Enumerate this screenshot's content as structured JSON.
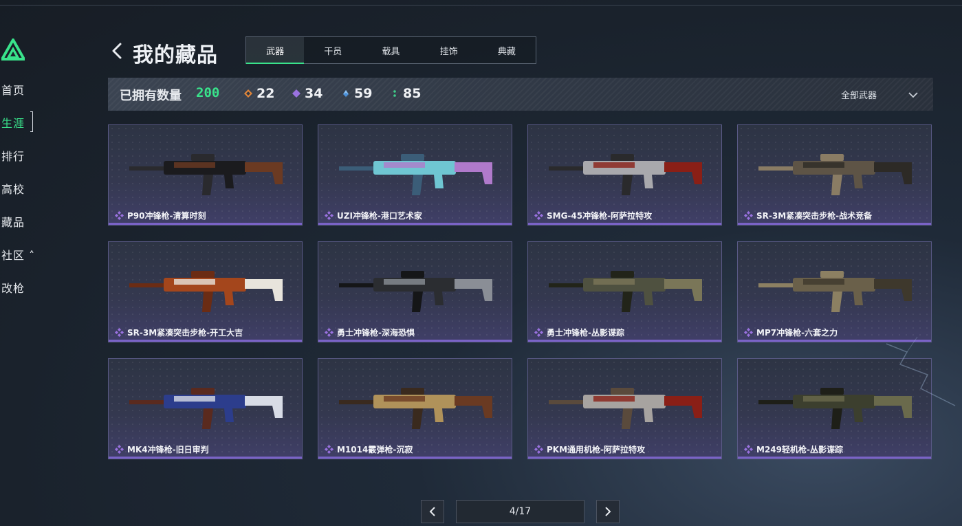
{
  "sidebar": {
    "items": [
      {
        "label": "首页"
      },
      {
        "label": "生涯"
      },
      {
        "label": "排行"
      },
      {
        "label": "高校"
      },
      {
        "label": "藏品"
      },
      {
        "label": "社区 ˄"
      },
      {
        "label": "改枪"
      }
    ],
    "active_index": 1
  },
  "header": {
    "title": "我的藏品",
    "tabs": [
      {
        "label": "武器"
      },
      {
        "label": "干员"
      },
      {
        "label": "载具"
      },
      {
        "label": "挂饰"
      },
      {
        "label": "典藏"
      }
    ],
    "active_tab_index": 0
  },
  "stats": {
    "owned_label": "已拥有数量",
    "owned_count": "200",
    "rarities": [
      {
        "icon": "orange-diamond-icon",
        "color": "#e0853a",
        "count": "22"
      },
      {
        "icon": "purple-diamond-icon",
        "color": "#9a72e0",
        "count": "34"
      },
      {
        "icon": "blue-diamond-icon",
        "color": "#4a8fd8",
        "count": "59"
      },
      {
        "icon": "green-diamond-icon",
        "color": "#3fce8a",
        "count": "85"
      }
    ],
    "filter_label": "全部武器"
  },
  "items": [
    {
      "name": "P90冲锋枪-清算时刻",
      "colors": [
        "#1b1b1e",
        "#6b3a22",
        "#2a2a2e"
      ]
    },
    {
      "name": "UZI冲锋枪-港口艺术家",
      "colors": [
        "#6fc6d2",
        "#b07acb",
        "#3b5d78"
      ]
    },
    {
      "name": "SMG-45冲锋枪-阿萨拉特攻",
      "colors": [
        "#a9a9ad",
        "#8a1f16",
        "#2a2a2c"
      ]
    },
    {
      "name": "SR-3M紧凑突击步枪-战术竞备",
      "colors": [
        "#5e5446",
        "#2d2a26",
        "#8a7c64"
      ]
    },
    {
      "name": "SR-3M紧凑突击步枪-开工大吉",
      "colors": [
        "#a4461c",
        "#e8e4dc",
        "#6b2c14"
      ]
    },
    {
      "name": "勇士冲锋枪-深海恐惧",
      "colors": [
        "#2b2d31",
        "#8a8e96",
        "#151618"
      ]
    },
    {
      "name": "勇士冲锋枪-丛影谍踪",
      "colors": [
        "#4f5140",
        "#7a7658",
        "#222419"
      ]
    },
    {
      "name": "MP7冲锋枪-六套之力",
      "colors": [
        "#6a604a",
        "#3e382c",
        "#8c8062"
      ]
    },
    {
      "name": "MK4冲锋枪-旧日审判",
      "colors": [
        "#2c3d8c",
        "#d8dce6",
        "#5a2a1e"
      ]
    },
    {
      "name": "M1014霰弹枪-沉寂",
      "colors": [
        "#b0925a",
        "#6a3a22",
        "#3a2a1e"
      ]
    },
    {
      "name": "PKM通用机枪-阿萨拉特攻",
      "colors": [
        "#a7a3a0",
        "#8a1f16",
        "#5a4a3c"
      ]
    },
    {
      "name": "M249轻机枪-丛影谍踪",
      "colors": [
        "#3c3f2e",
        "#6a6a4c",
        "#1e1f18"
      ]
    }
  ],
  "item_rarity_color": "#9a72e0",
  "pagination": {
    "label": "4/17",
    "current": 4,
    "total": 17
  },
  "accent_color": "#39e38b"
}
